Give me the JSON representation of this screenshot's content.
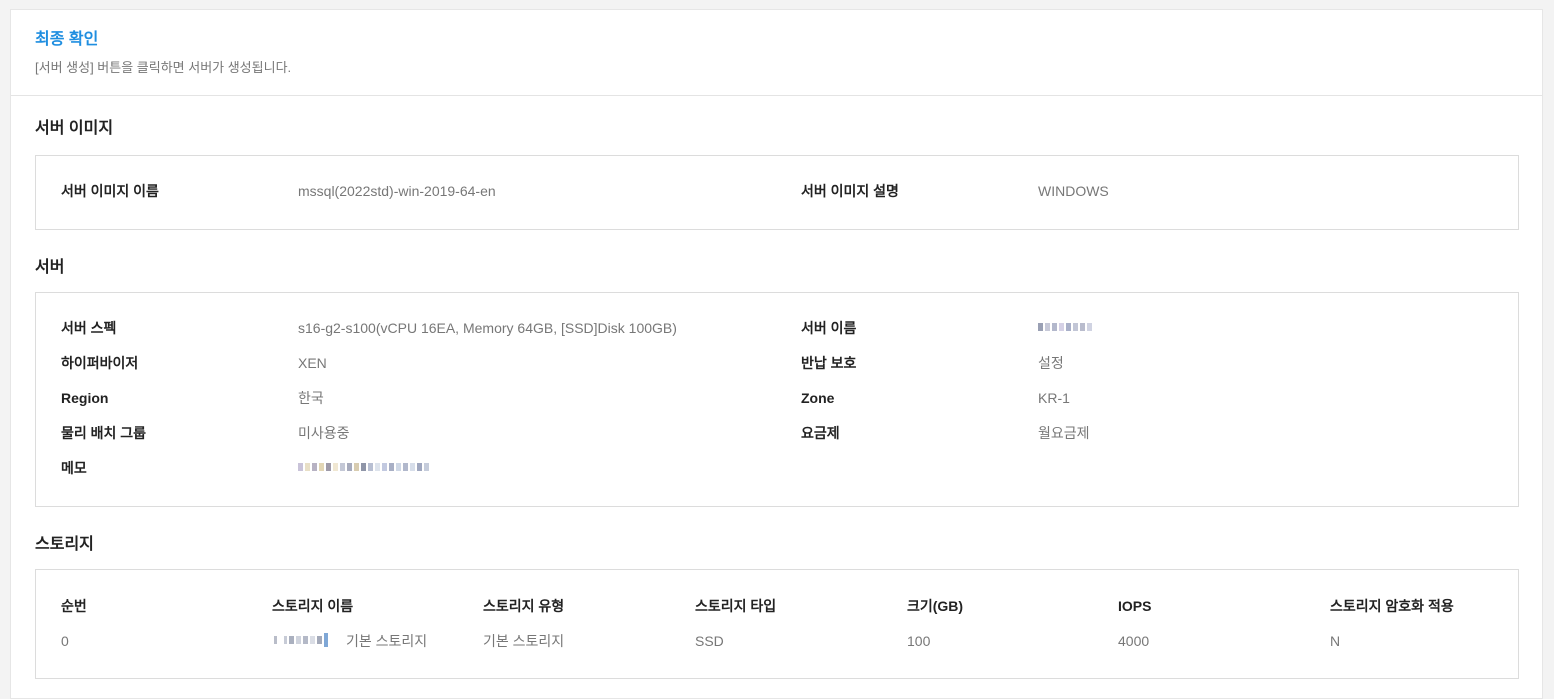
{
  "header": {
    "title": "최종 확인",
    "description": "[서버 생성] 버튼을 클릭하면 서버가 생성됩니다."
  },
  "server_image": {
    "section_title": "서버 이미지",
    "name_label": "서버 이미지 이름",
    "name_value": "mssql(2022std)-win-2019-64-en",
    "desc_label": "서버 이미지 설명",
    "desc_value": "WINDOWS"
  },
  "server": {
    "section_title": "서버",
    "spec_label": "서버 스펙",
    "spec_value": "s16-g2-s100(vCPU 16EA, Memory 64GB, [SSD]Disk 100GB)",
    "name_label": "서버 이름",
    "hypervisor_label": "하이퍼바이저",
    "hypervisor_value": "XEN",
    "return_protect_label": "반납 보호",
    "return_protect_value": "설정",
    "region_label": "Region",
    "region_value": "한국",
    "zone_label": "Zone",
    "zone_value": "KR-1",
    "placement_label": "물리 배치 그룹",
    "placement_value": "미사용중",
    "pricing_label": "요금제",
    "pricing_value": "월요금제",
    "memo_label": "메모"
  },
  "storage": {
    "section_title": "스토리지",
    "columns": [
      "순번",
      "스토리지 이름",
      "스토리지 유형",
      "스토리지 타입",
      "크기(GB)",
      "IOPS",
      "스토리지 암호화 적용"
    ],
    "rows": [
      {
        "index": "0",
        "name_suffix": "기본 스토리지",
        "kind": "기본 스토리지",
        "type": "SSD",
        "size": "100",
        "iops": "4000",
        "encrypted": "N"
      }
    ]
  }
}
